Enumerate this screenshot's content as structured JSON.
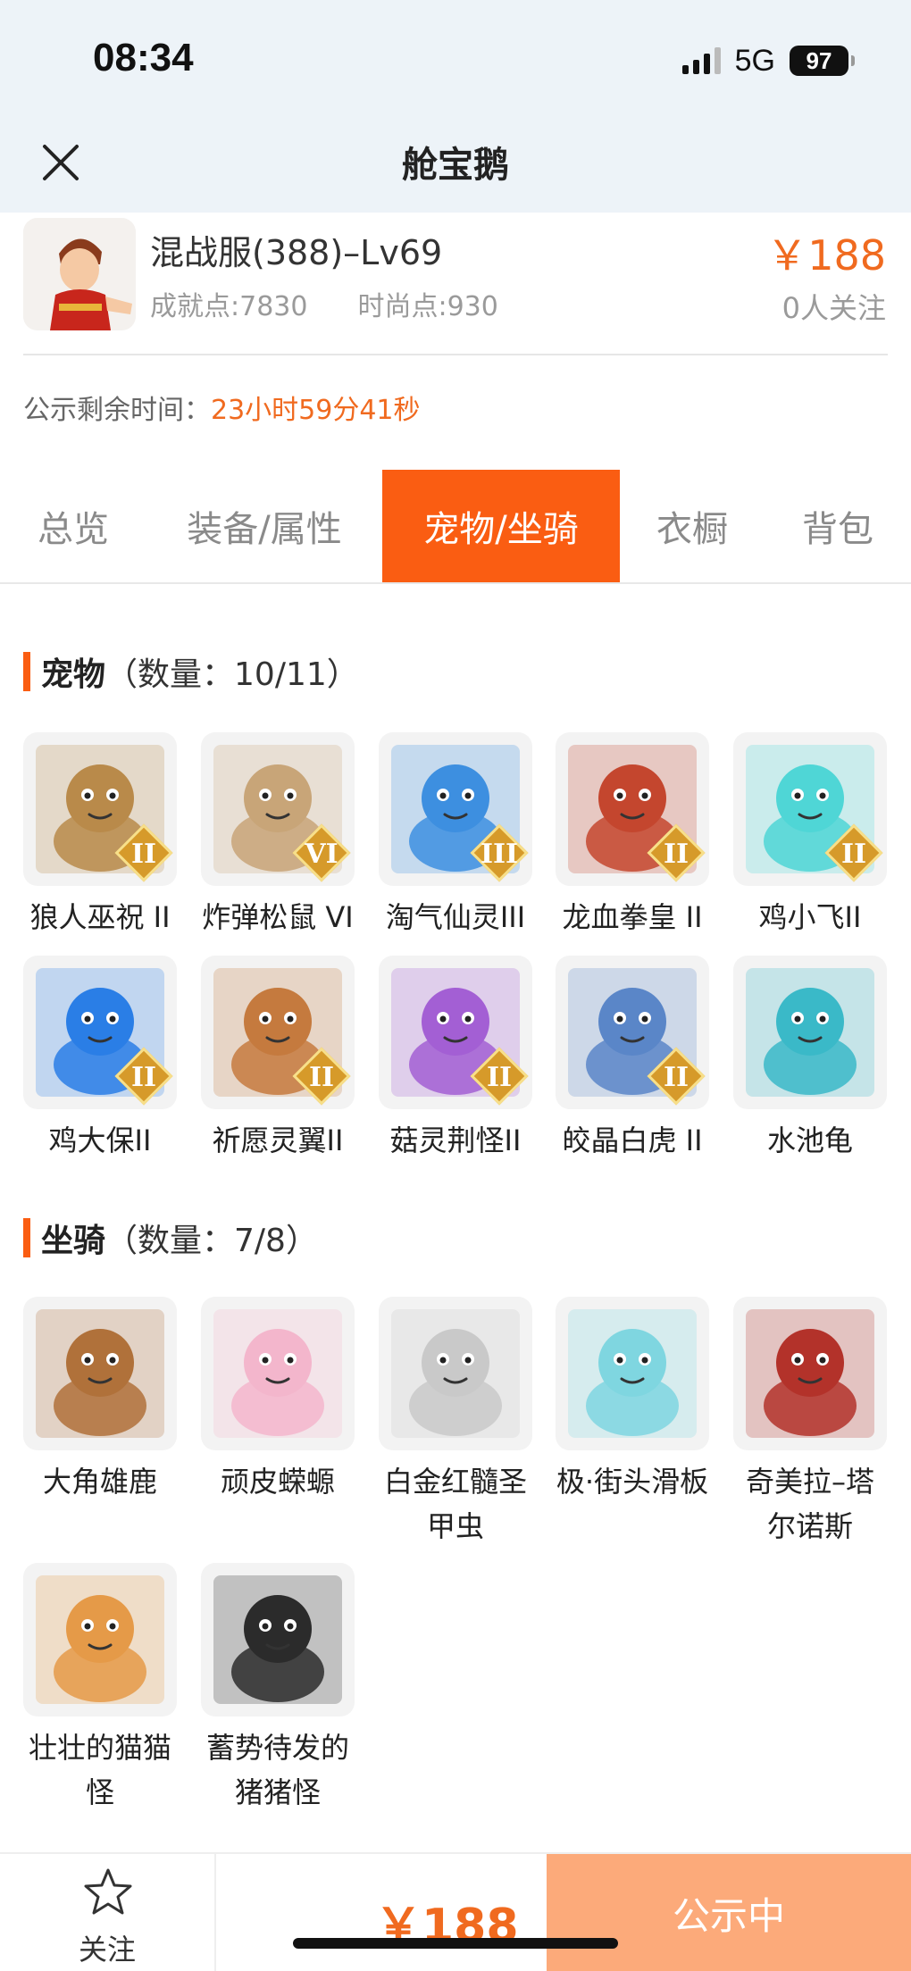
{
  "status_bar": {
    "time": "08:34",
    "network": "5G",
    "battery": "97"
  },
  "header": {
    "title": "舱宝鹅"
  },
  "item": {
    "server": "混战服(388)–Lv69",
    "achievement": "成就点:7830",
    "fashion": "时尚点:930",
    "price": "￥188",
    "followers": "0人关注",
    "countdown_label": "公示剩余时间：",
    "countdown_value": "23小时59分41秒"
  },
  "tabs": [
    "总览",
    "装备/属性",
    "宠物/坐骑",
    "衣橱",
    "背包"
  ],
  "active_tab": "宠物/坐骑",
  "pets_section": {
    "name": "宠物",
    "count": "（数量：10/11）",
    "items": [
      {
        "label": "狼人巫祝 II",
        "badge": "II",
        "icon": "werewolf-pet-icon",
        "color": "#b98a4a"
      },
      {
        "label": "炸弹松鼠 VI",
        "badge": "VI",
        "icon": "squirrel-pet-icon",
        "color": "#c8a578"
      },
      {
        "label": "淘气仙灵III",
        "badge": "III",
        "icon": "blue-dog-pet-icon",
        "color": "#3d8fe0"
      },
      {
        "label": "龙血拳皇 II",
        "badge": "II",
        "icon": "dragon-fighter-pet-icon",
        "color": "#c4462e"
      },
      {
        "label": "鸡小飞II",
        "badge": "II",
        "icon": "chick-fighter-pet-icon",
        "color": "#4fd6d6"
      },
      {
        "label": "鸡大保II",
        "badge": "II",
        "icon": "blue-chicken-pet-icon",
        "color": "#2a7ee6"
      },
      {
        "label": "祈愿灵翼II",
        "badge": "II",
        "icon": "griffin-pet-icon",
        "color": "#c57a3e"
      },
      {
        "label": "菇灵荆怪II",
        "badge": "II",
        "icon": "mushroom-sprite-pet-icon",
        "color": "#a35fd4"
      },
      {
        "label": "皎晶白虎 II",
        "badge": "II",
        "icon": "white-tiger-pet-icon",
        "color": "#5a86c8"
      },
      {
        "label": "水池龟",
        "badge": "",
        "icon": "pond-turtle-pet-icon",
        "color": "#3ab9c8"
      }
    ]
  },
  "mounts_section": {
    "name": "坐骑",
    "count": "（数量：7/8）",
    "items": [
      {
        "label": "大角雄鹿",
        "icon": "stag-mount-icon",
        "color": "#b0713a"
      },
      {
        "label": "顽皮蝾螈",
        "icon": "salamander-mount-icon",
        "color": "#f3b6cc"
      },
      {
        "label": "白金红髓圣甲虫",
        "icon": "scarab-mount-icon",
        "color": "#c9c9c9"
      },
      {
        "label": "极·街头滑板",
        "icon": "skateboard-mount-icon",
        "color": "#7fd6e0"
      },
      {
        "label": "奇美拉–塔尔诺斯",
        "icon": "chimera-mount-icon",
        "color": "#b3322a"
      },
      {
        "label": "壮壮的猫猫怪",
        "icon": "cat-monster-mount-icon",
        "color": "#e59a48"
      },
      {
        "label": "蓄势待发的猪猪怪",
        "icon": "pig-monster-mount-icon",
        "color": "#2b2b2b"
      }
    ]
  },
  "bottom_bar": {
    "follow_label": "关注",
    "price": "￥188",
    "state_label": "公示中"
  }
}
